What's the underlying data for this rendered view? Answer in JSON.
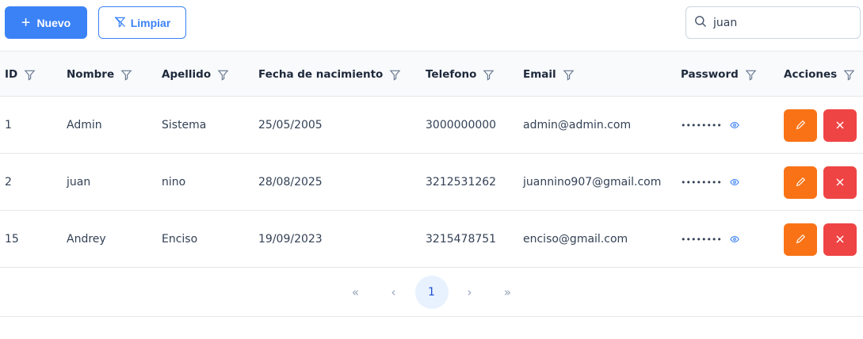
{
  "toolbar": {
    "new_label": "Nuevo",
    "new_icon": "plus-icon",
    "clear_label": "Limpiar",
    "clear_icon": "filter-slash-icon",
    "search_value": "juan",
    "search_icon": "search-icon"
  },
  "columns": [
    {
      "label": "ID"
    },
    {
      "label": "Nombre"
    },
    {
      "label": "Apellido"
    },
    {
      "label": "Fecha de nacimiento"
    },
    {
      "label": "Telefono"
    },
    {
      "label": "Email"
    },
    {
      "label": "Password"
    },
    {
      "label": "Acciones"
    }
  ],
  "rows": [
    {
      "id": "1",
      "nombre": "Admin",
      "apellido": "Sistema",
      "fecha": "25/05/2005",
      "telefono": "3000000000",
      "email": "admin@admin.com",
      "password": "••••••••"
    },
    {
      "id": "2",
      "nombre": "juan",
      "apellido": "nino",
      "fecha": "28/08/2025",
      "telefono": "3212531262",
      "email": "juannino907@gmail.com",
      "password": "••••••••"
    },
    {
      "id": "15",
      "nombre": "Andrey",
      "apellido": "Enciso",
      "fecha": "19/09/2023",
      "telefono": "3215478751",
      "email": "enciso@gmail.com",
      "password": "••••••••"
    }
  ],
  "pagination": {
    "first": "«",
    "prev": "‹",
    "current_page": "1",
    "next": "›",
    "last": "»"
  },
  "colors": {
    "primary": "#3b82f6",
    "edit": "#f97316",
    "delete": "#ef4444",
    "header_bg": "#f8fafc"
  }
}
